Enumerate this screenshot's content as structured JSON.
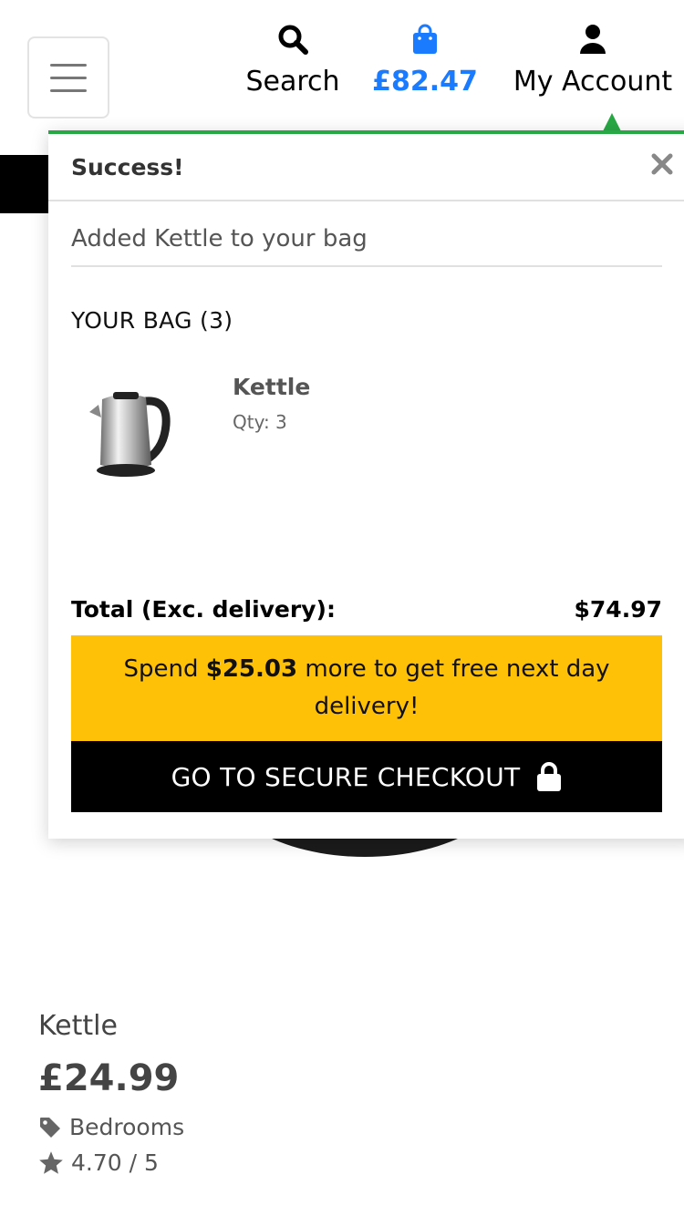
{
  "header": {
    "menu_icon": "hamburger-icon",
    "search": {
      "icon": "search-icon",
      "label": "Search"
    },
    "bag": {
      "icon": "shopping-bag-icon",
      "label": "£82.47",
      "color": "#1a7bff"
    },
    "account": {
      "icon": "user-icon",
      "label": "My Account"
    }
  },
  "toast": {
    "accent_color": "#28a745",
    "title": "Success!",
    "close_icon": "close-icon",
    "message": "Added Kettle to your bag",
    "bag_heading": "YOUR BAG (3)",
    "items": [
      {
        "name": "Kettle",
        "qty": "Qty: 3",
        "image": "kettle-thumbnail"
      }
    ],
    "total_label": "Total (Exc. delivery):",
    "total_value": "$74.97",
    "delivery": {
      "prefix": "Spend ",
      "amount": "$25.03",
      "suffix": " more to get free next day delivery!",
      "background": "#ffc107"
    },
    "checkout": {
      "label": "GO TO SECURE CHECKOUT",
      "icon": "lock-icon"
    }
  },
  "product": {
    "name": "Kettle",
    "price": "£24.99",
    "category": {
      "icon": "tag-icon",
      "label": "Bedrooms"
    },
    "rating": {
      "icon": "star-icon",
      "label": "4.70 / 5"
    }
  }
}
